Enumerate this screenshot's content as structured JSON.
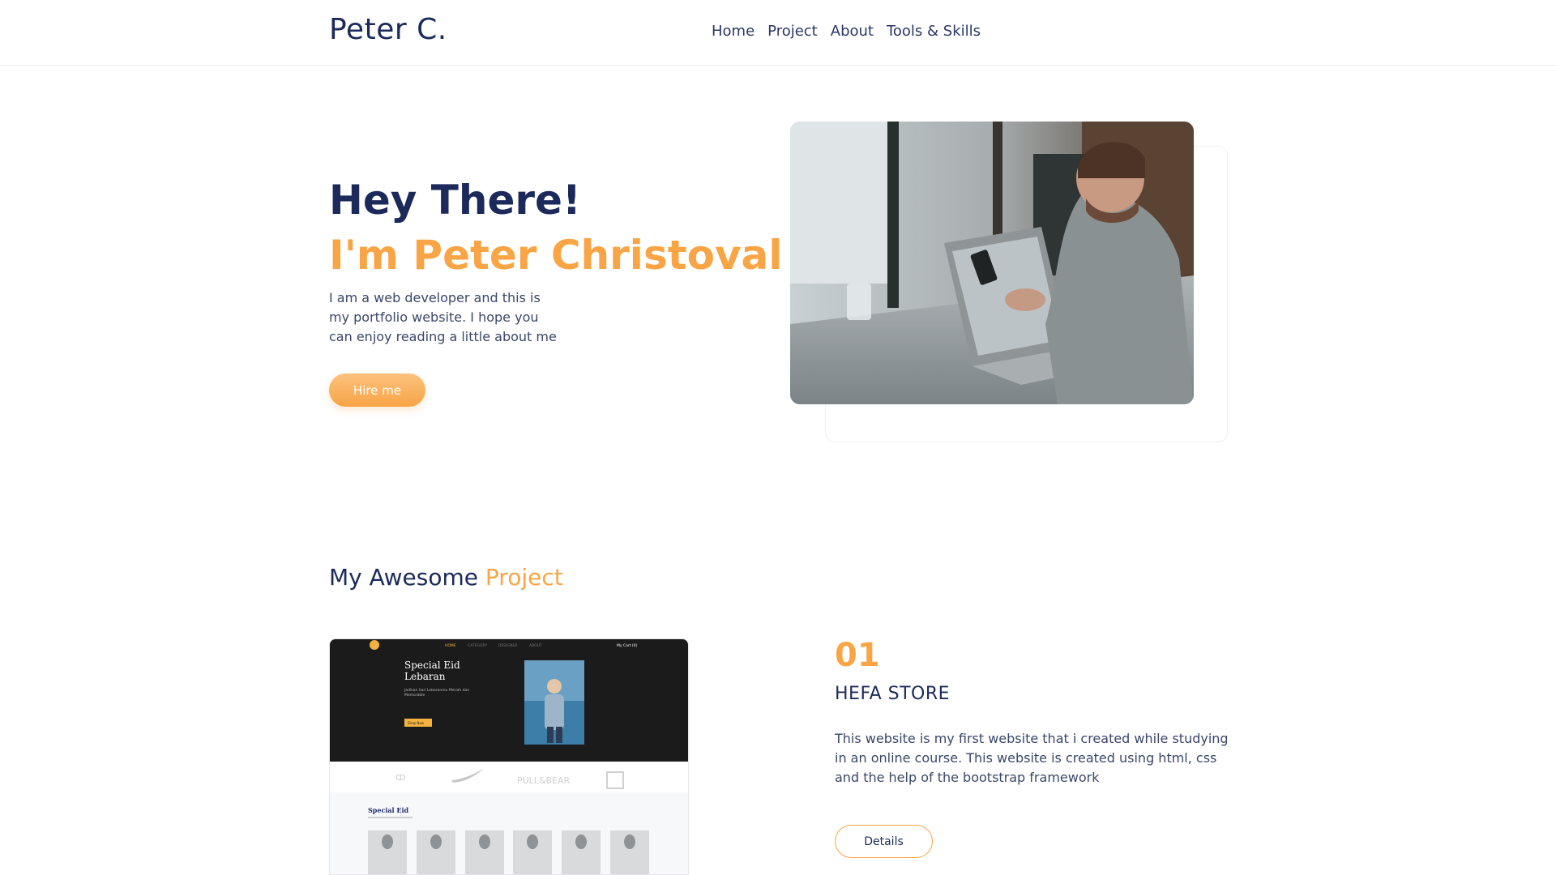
{
  "navbar": {
    "brand": "Peter C.",
    "links": [
      "Home",
      "Project",
      "About",
      "Tools & Skills"
    ]
  },
  "hero": {
    "greeting": "Hey There!",
    "name": "I'm Peter Christoval",
    "description": "I am a web developer and this is my portfolio website. I hope you can enjoy reading a little about me",
    "cta_label": "Hire me"
  },
  "projects": {
    "heading_prefix": "My Awesome",
    "heading_accent": "Project",
    "items": [
      {
        "number": "01",
        "name": "HEFA STORE",
        "description": "This website is my first website that i created while studying in an online course. This website is created using html, css and the help of the bootstrap framework",
        "details_label": "Details"
      }
    ]
  },
  "screenshot": {
    "nav": [
      "HOME",
      "CATEGORY",
      "DESIGNER",
      "ABOUT"
    ],
    "cart": "My Cart (0)",
    "banner_title_1": "Special Eid",
    "banner_title_2": "Lebaran",
    "banner_sub_1": "Jadikan hari Lebaranmu Meriah dan",
    "banner_sub_2": "Memorable",
    "banner_btn": "Shop Now",
    "brand_pullbear": "PULL&BEAR",
    "section_title": "Special Eid"
  },
  "colors": {
    "navy": "#1b2a5a",
    "accent": "#f9a545"
  }
}
